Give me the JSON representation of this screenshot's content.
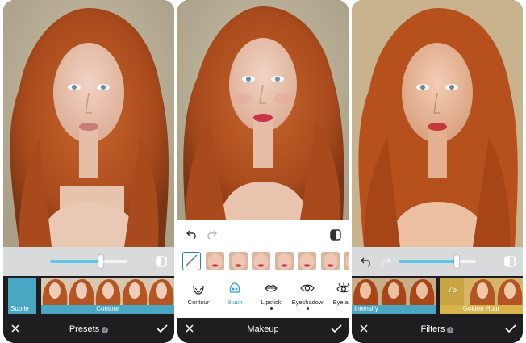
{
  "screens": [
    {
      "panel": "presets",
      "title": "Presets",
      "intensity": 0.66,
      "presets": [
        {
          "label": "Subtle",
          "selected": false
        },
        {
          "label": "Contour",
          "selected": true
        }
      ]
    },
    {
      "panel": "makeup",
      "title": "Makeup",
      "tools": [
        "Contour",
        "Blush",
        "Lipstick",
        "Eyeshadow",
        "Eyelash"
      ],
      "active_tool": "Blush",
      "swatch_count": 7
    },
    {
      "panel": "filters",
      "title": "Filters",
      "intensity": 0.75,
      "filters": [
        {
          "label": "Intensify",
          "selected": false
        },
        {
          "label": "Golden Hour",
          "selected": true,
          "value": "75"
        }
      ]
    }
  ],
  "icons": {
    "close": "close-icon",
    "apply": "check-icon",
    "info": "info-icon",
    "compare": "compare-icon",
    "undo": "undo-icon",
    "redo": "redo-icon"
  },
  "colors": {
    "accent": "#5fc6e6",
    "active_tool": "#2aa3d1",
    "preset_tile": "#4aa7c4",
    "golden_tile": "#d7b54c",
    "bar_bg": "#1e1e21"
  }
}
